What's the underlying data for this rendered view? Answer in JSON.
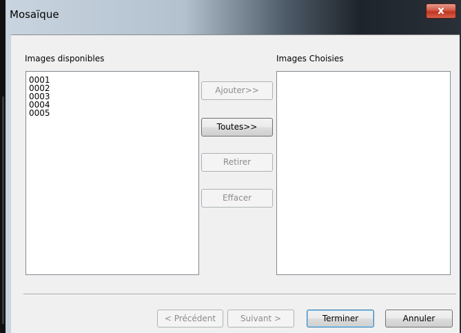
{
  "window": {
    "title": "Mosaïque",
    "close_glyph": "x"
  },
  "available": {
    "label": "Images disponibles",
    "items": [
      "0001",
      "0002",
      "0003",
      "0004",
      "0005"
    ]
  },
  "chosen": {
    "label": "Images Choisies",
    "items": []
  },
  "buttons": {
    "add": "Ajouter>>",
    "all": "Toutes>>",
    "remove": "Retirer",
    "clear": "Effacer"
  },
  "footer": {
    "prev": "< Précédent",
    "next": "Suivant >",
    "finish": "Terminer",
    "cancel": "Annuler"
  }
}
